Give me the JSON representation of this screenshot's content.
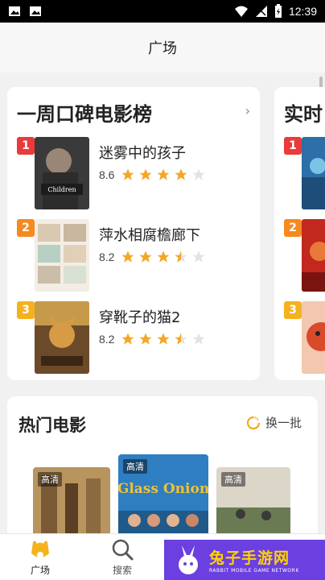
{
  "status_bar": {
    "time": "12:39"
  },
  "header": {
    "title": "广场"
  },
  "ranking_card": {
    "title": "一周口碑电影榜",
    "items": [
      {
        "rank": "1",
        "name": "迷雾中的孩子",
        "score": "8.6",
        "stars": 4
      },
      {
        "rank": "2",
        "name": "萍水相腐檐廊下",
        "score": "8.2",
        "stars": 3.5
      },
      {
        "rank": "3",
        "name": "穿靴子的猫2",
        "score": "8.2",
        "stars": 3.5
      }
    ]
  },
  "realtime_card": {
    "title": "实时",
    "ranks": [
      "1",
      "2",
      "3"
    ]
  },
  "hot_movies": {
    "title": "热门电影",
    "refresh_label": "换一批",
    "posters": [
      {
        "badge": "高清"
      },
      {
        "badge": "高清"
      },
      {
        "badge": "高清"
      }
    ]
  },
  "bottom_nav": {
    "items": [
      {
        "label": "广场"
      },
      {
        "label": "搜索"
      }
    ]
  },
  "watermark": {
    "main": "兔子手游网",
    "sub": "RABBIT MOBILE GAME NETWORK"
  },
  "colors": {
    "accent": "#f5b21f",
    "rank1": "#ea3a3a",
    "rank2": "#f58a1f",
    "rank3": "#f5b21f"
  }
}
